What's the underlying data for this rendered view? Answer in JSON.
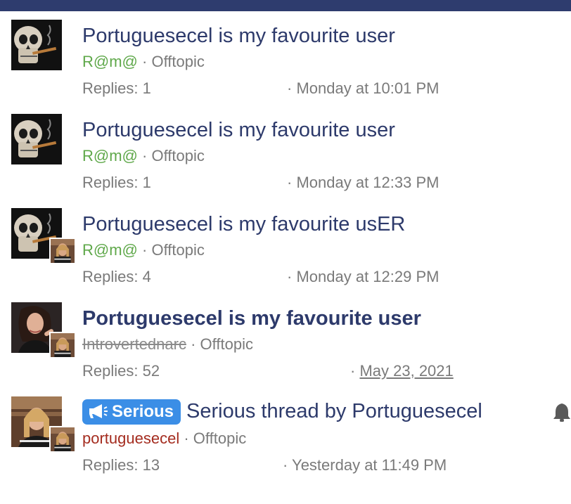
{
  "threads": [
    {
      "title": "Portuguesecel is my favourite user",
      "user": "R@m@",
      "separator": "·",
      "forum": "Offtopic",
      "replies": "Replies: 1",
      "date_prefix": "·",
      "date": "Monday at 10:01 PM"
    },
    {
      "title": "Portuguesecel is my favourite user",
      "user": "R@m@",
      "separator": "·",
      "forum": "Offtopic",
      "replies": "Replies: 1",
      "date_prefix": "·",
      "date": "Monday at 12:33 PM"
    },
    {
      "title": "Portuguesecel is my favourite usER",
      "user": "R@m@",
      "separator": "·",
      "forum": "Offtopic",
      "replies": "Replies: 4",
      "date_prefix": "·",
      "date": "Monday at 12:29 PM"
    },
    {
      "title": "Portuguesecel is my favourite user",
      "user": "Introvertednarc",
      "separator": "·",
      "forum": "Offtopic",
      "replies": "Replies: 52",
      "date_prefix": "·",
      "date": "May 23, 2021"
    },
    {
      "prefix_label": "Serious",
      "title": "Serious thread by Portuguesecel",
      "user": "portuguesecel",
      "separator": "·",
      "forum": "Offtopic",
      "replies": "Replies: 13",
      "date_prefix": "·",
      "date": "Yesterday at 11:49 PM"
    }
  ],
  "colors": {
    "topbar": "#2e3c6e",
    "title": "#2d3a6b",
    "user_green": "#5fa84a",
    "user_red": "#a42c1f",
    "label_blue": "#3b8ee6"
  },
  "icons": {
    "label": "megaphone-icon",
    "watch": "bell-icon"
  }
}
